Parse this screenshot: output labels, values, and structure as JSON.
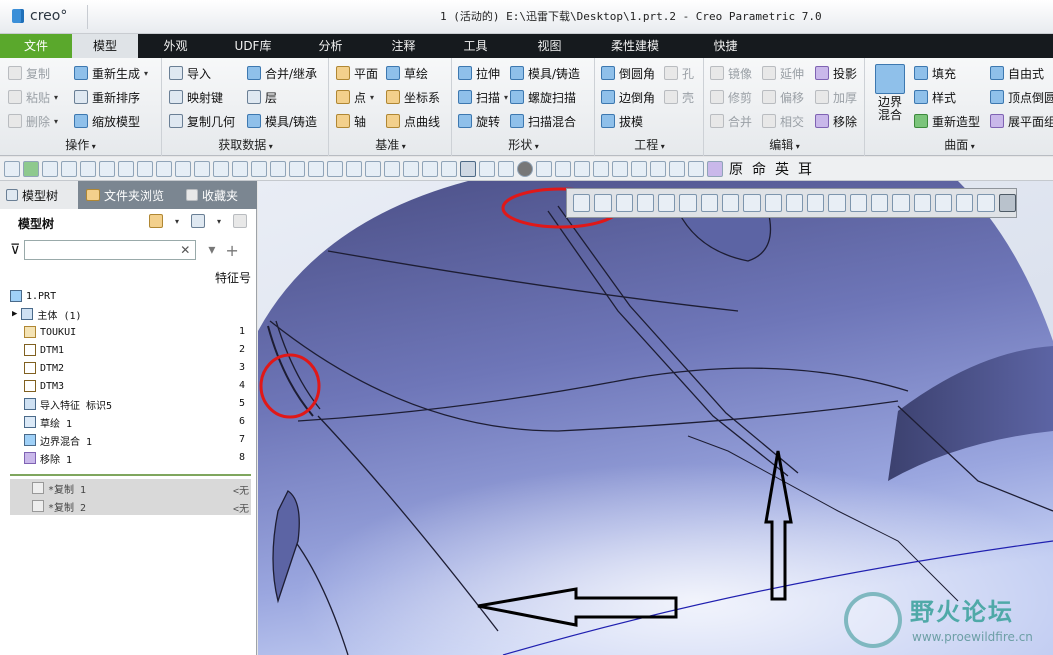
{
  "app": {
    "logo": "creo°",
    "window_title": "1 (活动的) E:\\迅雷下载\\Desktop\\1.prt.2 - Creo Parametric 7.0"
  },
  "tabs": [
    "文件",
    "模型",
    "外观",
    "UDF库",
    "分析",
    "注释",
    "工具",
    "视图",
    "柔性建模",
    "快捷"
  ],
  "ribbon": {
    "ops": {
      "label": "操作",
      "copy": "复制",
      "paste": "粘贴",
      "delete": "删除",
      "regen": "重新生成",
      "reorder": "重新排序",
      "shrink": "缩放模型"
    },
    "getdata": {
      "label": "获取数据",
      "import": "导入",
      "mapkey": "映射键",
      "copygeom": "复制几何",
      "merge": "合并/继承",
      "layer": "层",
      "mold": "模具/铸造"
    },
    "datum": {
      "label": "基准",
      "plane": "平面",
      "sketch": "草绘",
      "point": "点",
      "csys": "坐标系",
      "axis": "轴",
      "curve": "点曲线"
    },
    "shapes": {
      "label": "形状",
      "extrude": "拉伸",
      "mold_cast": "模具/铸造",
      "sweep": "扫描",
      "helical": "螺旋扫描",
      "revolve": "旋转",
      "swept_blend": "扫描混合"
    },
    "eng": {
      "label": "工程",
      "round": "倒圆角",
      "hole": "孔",
      "chamfer": "边倒角",
      "shell": "壳",
      "draft": "拔模"
    },
    "edit": {
      "label": "编辑",
      "mirror": "镜像",
      "extend": "延伸",
      "project": "投影",
      "trim": "修剪",
      "offset": "偏移",
      "thicken": "加厚",
      "merge": "合并",
      "intersect": "相交",
      "remove": "移除"
    },
    "surface": {
      "label": "曲面",
      "boundary_blend": "边界混合",
      "fill": "填充",
      "style": "样式",
      "restyle": "重新造型",
      "freestyle": "自由式",
      "vertex_round": "顶点倒圆",
      "unwrap": "展平面组"
    }
  },
  "quickbar": {
    "text1": "原",
    "text2": "命",
    "text3": "英",
    "text4": "耳"
  },
  "left_panel": {
    "tabs": [
      "模型树",
      "文件夹浏览",
      "收藏夹"
    ],
    "title": "模型树",
    "filter_placeholder": "",
    "column_header": "特征号",
    "tree": [
      {
        "label": "1.PRT",
        "num": ""
      },
      {
        "label": "主体 (1)",
        "num": ""
      },
      {
        "label": "TOUKUI",
        "num": "1"
      },
      {
        "label": "DTM1",
        "num": "2"
      },
      {
        "label": "DTM2",
        "num": "3"
      },
      {
        "label": "DTM3",
        "num": "4"
      },
      {
        "label": "导入特征 标识5",
        "num": "5"
      },
      {
        "label": "草绘 1",
        "num": "6"
      },
      {
        "label": "边界混合 1",
        "num": "7"
      },
      {
        "label": "移除 1",
        "num": "8"
      }
    ],
    "disabled": [
      {
        "label": "*复制 1",
        "tag": "<无"
      },
      {
        "label": "*复制 2",
        "tag": "<无"
      }
    ]
  },
  "watermark": {
    "title": "野火论坛",
    "url": "www.proewildfire.cn"
  },
  "colors": {
    "accent_green": "#5aa82c",
    "model_blue": "#6670b4",
    "annotation_red": "#e01818"
  }
}
